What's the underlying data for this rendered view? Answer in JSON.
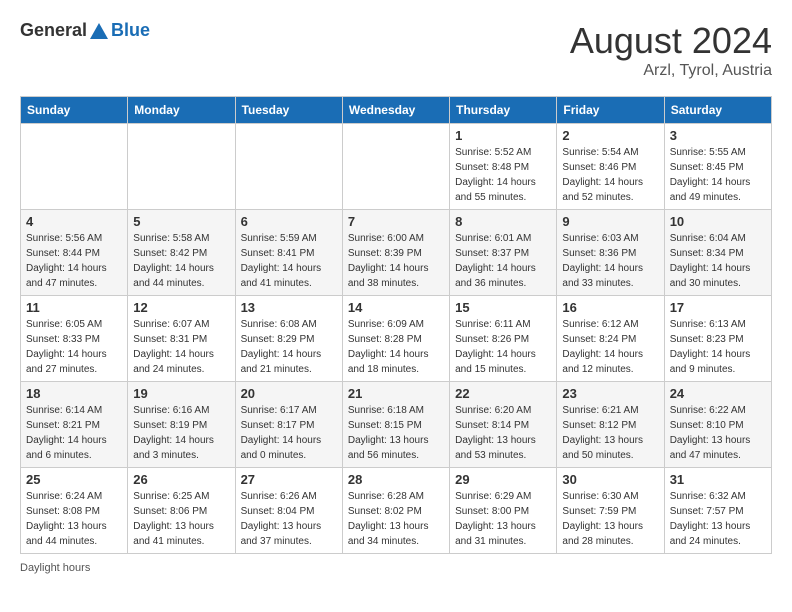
{
  "header": {
    "logo_general": "General",
    "logo_blue": "Blue",
    "month_year": "August 2024",
    "location": "Arzl, Tyrol, Austria"
  },
  "weekdays": [
    "Sunday",
    "Monday",
    "Tuesday",
    "Wednesday",
    "Thursday",
    "Friday",
    "Saturday"
  ],
  "weeks": [
    [
      {
        "day": "",
        "sunrise": "",
        "sunset": "",
        "daylight": ""
      },
      {
        "day": "",
        "sunrise": "",
        "sunset": "",
        "daylight": ""
      },
      {
        "day": "",
        "sunrise": "",
        "sunset": "",
        "daylight": ""
      },
      {
        "day": "",
        "sunrise": "",
        "sunset": "",
        "daylight": ""
      },
      {
        "day": "1",
        "sunrise": "Sunrise: 5:52 AM",
        "sunset": "Sunset: 8:48 PM",
        "daylight": "Daylight: 14 hours and 55 minutes."
      },
      {
        "day": "2",
        "sunrise": "Sunrise: 5:54 AM",
        "sunset": "Sunset: 8:46 PM",
        "daylight": "Daylight: 14 hours and 52 minutes."
      },
      {
        "day": "3",
        "sunrise": "Sunrise: 5:55 AM",
        "sunset": "Sunset: 8:45 PM",
        "daylight": "Daylight: 14 hours and 49 minutes."
      }
    ],
    [
      {
        "day": "4",
        "sunrise": "Sunrise: 5:56 AM",
        "sunset": "Sunset: 8:44 PM",
        "daylight": "Daylight: 14 hours and 47 minutes."
      },
      {
        "day": "5",
        "sunrise": "Sunrise: 5:58 AM",
        "sunset": "Sunset: 8:42 PM",
        "daylight": "Daylight: 14 hours and 44 minutes."
      },
      {
        "day": "6",
        "sunrise": "Sunrise: 5:59 AM",
        "sunset": "Sunset: 8:41 PM",
        "daylight": "Daylight: 14 hours and 41 minutes."
      },
      {
        "day": "7",
        "sunrise": "Sunrise: 6:00 AM",
        "sunset": "Sunset: 8:39 PM",
        "daylight": "Daylight: 14 hours and 38 minutes."
      },
      {
        "day": "8",
        "sunrise": "Sunrise: 6:01 AM",
        "sunset": "Sunset: 8:37 PM",
        "daylight": "Daylight: 14 hours and 36 minutes."
      },
      {
        "day": "9",
        "sunrise": "Sunrise: 6:03 AM",
        "sunset": "Sunset: 8:36 PM",
        "daylight": "Daylight: 14 hours and 33 minutes."
      },
      {
        "day": "10",
        "sunrise": "Sunrise: 6:04 AM",
        "sunset": "Sunset: 8:34 PM",
        "daylight": "Daylight: 14 hours and 30 minutes."
      }
    ],
    [
      {
        "day": "11",
        "sunrise": "Sunrise: 6:05 AM",
        "sunset": "Sunset: 8:33 PM",
        "daylight": "Daylight: 14 hours and 27 minutes."
      },
      {
        "day": "12",
        "sunrise": "Sunrise: 6:07 AM",
        "sunset": "Sunset: 8:31 PM",
        "daylight": "Daylight: 14 hours and 24 minutes."
      },
      {
        "day": "13",
        "sunrise": "Sunrise: 6:08 AM",
        "sunset": "Sunset: 8:29 PM",
        "daylight": "Daylight: 14 hours and 21 minutes."
      },
      {
        "day": "14",
        "sunrise": "Sunrise: 6:09 AM",
        "sunset": "Sunset: 8:28 PM",
        "daylight": "Daylight: 14 hours and 18 minutes."
      },
      {
        "day": "15",
        "sunrise": "Sunrise: 6:11 AM",
        "sunset": "Sunset: 8:26 PM",
        "daylight": "Daylight: 14 hours and 15 minutes."
      },
      {
        "day": "16",
        "sunrise": "Sunrise: 6:12 AM",
        "sunset": "Sunset: 8:24 PM",
        "daylight": "Daylight: 14 hours and 12 minutes."
      },
      {
        "day": "17",
        "sunrise": "Sunrise: 6:13 AM",
        "sunset": "Sunset: 8:23 PM",
        "daylight": "Daylight: 14 hours and 9 minutes."
      }
    ],
    [
      {
        "day": "18",
        "sunrise": "Sunrise: 6:14 AM",
        "sunset": "Sunset: 8:21 PM",
        "daylight": "Daylight: 14 hours and 6 minutes."
      },
      {
        "day": "19",
        "sunrise": "Sunrise: 6:16 AM",
        "sunset": "Sunset: 8:19 PM",
        "daylight": "Daylight: 14 hours and 3 minutes."
      },
      {
        "day": "20",
        "sunrise": "Sunrise: 6:17 AM",
        "sunset": "Sunset: 8:17 PM",
        "daylight": "Daylight: 14 hours and 0 minutes."
      },
      {
        "day": "21",
        "sunrise": "Sunrise: 6:18 AM",
        "sunset": "Sunset: 8:15 PM",
        "daylight": "Daylight: 13 hours and 56 minutes."
      },
      {
        "day": "22",
        "sunrise": "Sunrise: 6:20 AM",
        "sunset": "Sunset: 8:14 PM",
        "daylight": "Daylight: 13 hours and 53 minutes."
      },
      {
        "day": "23",
        "sunrise": "Sunrise: 6:21 AM",
        "sunset": "Sunset: 8:12 PM",
        "daylight": "Daylight: 13 hours and 50 minutes."
      },
      {
        "day": "24",
        "sunrise": "Sunrise: 6:22 AM",
        "sunset": "Sunset: 8:10 PM",
        "daylight": "Daylight: 13 hours and 47 minutes."
      }
    ],
    [
      {
        "day": "25",
        "sunrise": "Sunrise: 6:24 AM",
        "sunset": "Sunset: 8:08 PM",
        "daylight": "Daylight: 13 hours and 44 minutes."
      },
      {
        "day": "26",
        "sunrise": "Sunrise: 6:25 AM",
        "sunset": "Sunset: 8:06 PM",
        "daylight": "Daylight: 13 hours and 41 minutes."
      },
      {
        "day": "27",
        "sunrise": "Sunrise: 6:26 AM",
        "sunset": "Sunset: 8:04 PM",
        "daylight": "Daylight: 13 hours and 37 minutes."
      },
      {
        "day": "28",
        "sunrise": "Sunrise: 6:28 AM",
        "sunset": "Sunset: 8:02 PM",
        "daylight": "Daylight: 13 hours and 34 minutes."
      },
      {
        "day": "29",
        "sunrise": "Sunrise: 6:29 AM",
        "sunset": "Sunset: 8:00 PM",
        "daylight": "Daylight: 13 hours and 31 minutes."
      },
      {
        "day": "30",
        "sunrise": "Sunrise: 6:30 AM",
        "sunset": "Sunset: 7:59 PM",
        "daylight": "Daylight: 13 hours and 28 minutes."
      },
      {
        "day": "31",
        "sunrise": "Sunrise: 6:32 AM",
        "sunset": "Sunset: 7:57 PM",
        "daylight": "Daylight: 13 hours and 24 minutes."
      }
    ]
  ],
  "footer": {
    "note": "Daylight hours"
  }
}
